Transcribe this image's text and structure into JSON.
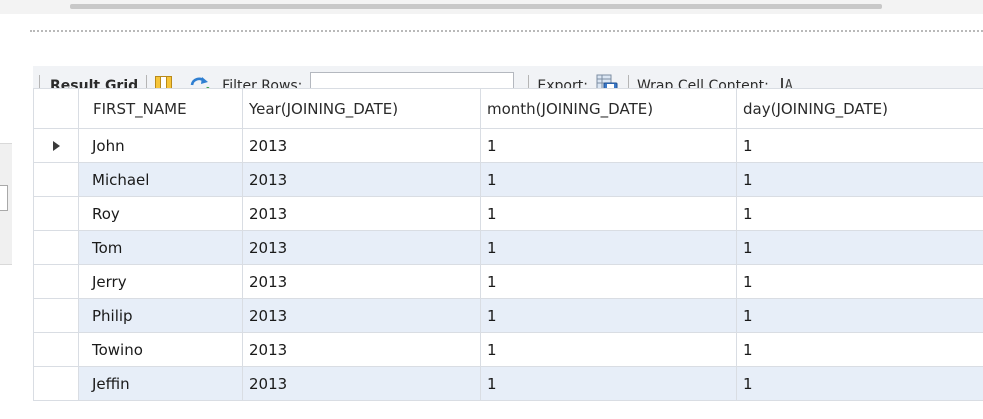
{
  "toolbar": {
    "result_grid_label": "Result Grid",
    "filter_rows_label": "Filter Rows:",
    "filter_rows_value": "",
    "export_label": "Export:",
    "wrap_cell_label": "Wrap Cell Content:",
    "wrap_icon_glyph": "A",
    "icons": [
      "result-grid-layout-icon",
      "refresh-icon",
      "export-save-icon",
      "wrap-text-icon"
    ]
  },
  "grid": {
    "columns": [
      "FIRST_NAME",
      "Year(JOINING_DATE)",
      "month(JOINING_DATE)",
      "day(JOINING_DATE)"
    ],
    "current_row_index": 0,
    "rows": [
      [
        "John",
        "2013",
        "1",
        "1"
      ],
      [
        "Michael",
        "2013",
        "1",
        "1"
      ],
      [
        "Roy",
        "2013",
        "1",
        "1"
      ],
      [
        "Tom",
        "2013",
        "1",
        "1"
      ],
      [
        "Jerry",
        "2013",
        "1",
        "1"
      ],
      [
        "Philip",
        "2013",
        "1",
        "1"
      ],
      [
        "Towino",
        "2013",
        "1",
        "1"
      ],
      [
        " Jeffin",
        "2013",
        "1",
        "1"
      ]
    ]
  },
  "colors": {
    "stripe": "#e7eef8",
    "grid_line": "#d9dde3",
    "toolbar_bg": "#f1f3f6",
    "icon_yellow": "#f6c53a",
    "icon_blue": "#2f7fd1"
  }
}
